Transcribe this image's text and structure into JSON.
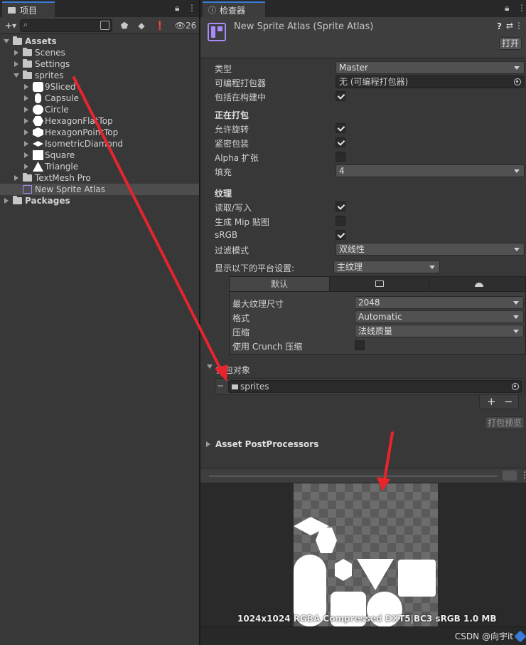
{
  "project_panel": {
    "tab_label": "项目",
    "hidden_count": "26",
    "add_label": "+▾",
    "tree": [
      {
        "label": "Assets",
        "bold": true,
        "expanded": true,
        "icon": "folder-icon"
      },
      {
        "label": "Scenes",
        "icon": "folder-icon"
      },
      {
        "label": "Settings",
        "icon": "folder-icon"
      },
      {
        "label": "sprites",
        "expanded": true,
        "icon": "folder-icon"
      },
      {
        "label": "9Sliced",
        "icon": "rounded-square-icon"
      },
      {
        "label": "Capsule",
        "icon": "capsule-icon"
      },
      {
        "label": "Circle",
        "icon": "circle-icon"
      },
      {
        "label": "HexagonFlatTop",
        "icon": "hexagon-flat-icon"
      },
      {
        "label": "HexagonPointTop",
        "icon": "hexagon-point-icon"
      },
      {
        "label": "IsometricDiamond",
        "icon": "diamond-icon"
      },
      {
        "label": "Square",
        "icon": "square-icon"
      },
      {
        "label": "Triangle",
        "icon": "triangle-icon"
      },
      {
        "label": "TextMesh Pro",
        "icon": "folder-icon"
      },
      {
        "label": "New Sprite Atlas",
        "selected": true,
        "icon": "sprite-atlas-icon"
      },
      {
        "label": "Packages",
        "bold": true,
        "icon": "folder-icon"
      }
    ]
  },
  "inspector": {
    "tab_label": "检查器",
    "title": "New Sprite Atlas (Sprite Atlas)",
    "open_button": "打开",
    "type_label": "类型",
    "type_value": "Master",
    "packer_label": "可编程打包器",
    "packer_value": "无 (可编程打包器)",
    "include_build_label": "包括在构建中",
    "include_build": true,
    "packing_section": "正在打包",
    "allow_rotation_label": "允许旋转",
    "allow_rotation": true,
    "tight_packing_label": "紧密包装",
    "tight_packing": true,
    "alpha_dilation_label": "Alpha 扩张",
    "alpha_dilation": false,
    "padding_label": "填充",
    "padding_value": "4",
    "texture_section": "纹理",
    "read_write_label": "读取/写入",
    "read_write": true,
    "mipmap_label": "生成 Mip 贴图",
    "mipmap": false,
    "srgb_label": "sRGB",
    "srgb": true,
    "filter_label": "过滤模式",
    "filter_value": "双线性",
    "platform_label": "显示以下的平台设置:",
    "platform_value": "主纹理",
    "platform_tabs": [
      "默认",
      "monitor-icon",
      "android-icon"
    ],
    "max_size_label": "最大纹理尺寸",
    "max_size_value": "2048",
    "format_label": "格式",
    "format_value": "Automatic",
    "compression_label": "压缩",
    "compression_value": "法线质量",
    "crunch_label": "使用 Crunch 压缩",
    "crunch": false,
    "objects_section": "打包对象",
    "objects": [
      {
        "label": "sprites",
        "icon": "folder-icon"
      }
    ],
    "add_button": "+",
    "remove_button": "−",
    "pack_preview_button": "打包预览",
    "postprocessors_section": "Asset PostProcessors",
    "preview_info": "1024x1024 RGBA Compressed DXT5|BC3 sRGB   1.0 MB"
  },
  "watermark": "CSDN @向宇it",
  "colors": {
    "accent": "#3a7ad9",
    "annotation_arrow": "#e8242c",
    "atlas_icon": "#a78bfa"
  }
}
